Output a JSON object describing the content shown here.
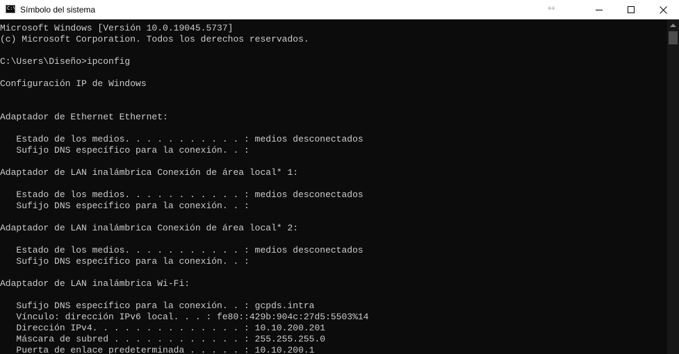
{
  "window": {
    "title": "Símbolo del sistema",
    "resize_glyph": "↔",
    "icon": "cmd-icon",
    "icon_text": "C:\\",
    "controls": [
      "minimize-icon",
      "maximize-icon",
      "close-icon"
    ]
  },
  "console": {
    "text_color": "#cccccc",
    "background": "#0c0c0c",
    "lines": [
      {
        "row": 0,
        "text": "Microsoft Windows [Versión 10.0.19045.5737]"
      },
      {
        "row": 1,
        "text": "(c) Microsoft Corporation. Todos los derechos reservados."
      },
      {
        "row": 3,
        "text": "C:\\Users\\Diseño>ipconfig"
      },
      {
        "row": 5,
        "text": "Configuración IP de Windows"
      },
      {
        "row": 8,
        "text": "Adaptador de Ethernet Ethernet:"
      },
      {
        "row": 10,
        "text": "   Estado de los medios. . . . . . . . . . . : medios desconectados"
      },
      {
        "row": 11,
        "text": "   Sufijo DNS específico para la conexión. . :"
      },
      {
        "row": 13,
        "text": "Adaptador de LAN inalámbrica Conexión de área local* 1:"
      },
      {
        "row": 15,
        "text": "   Estado de los medios. . . . . . . . . . . : medios desconectados"
      },
      {
        "row": 16,
        "text": "   Sufijo DNS específico para la conexión. . :"
      },
      {
        "row": 18,
        "text": "Adaptador de LAN inalámbrica Conexión de área local* 2:"
      },
      {
        "row": 20,
        "text": "   Estado de los medios. . . . . . . . . . . : medios desconectados"
      },
      {
        "row": 21,
        "text": "   Sufijo DNS específico para la conexión. . :"
      },
      {
        "row": 23,
        "text": "Adaptador de LAN inalámbrica Wi-Fi:"
      },
      {
        "row": 25,
        "text": "   Sufijo DNS específico para la conexión. . : gcpds.intra"
      },
      {
        "row": 26,
        "text": "   Vínculo: dirección IPv6 local. . . : fe80::429b:904c:27d5:5503%14"
      },
      {
        "row": 27,
        "text": "   Dirección IPv4. . . . . . . . . . . . . . : 10.10.200.201"
      },
      {
        "row": 28,
        "text": "   Máscara de subred . . . . . . . . . . . . : 255.255.255.0"
      },
      {
        "row": 29,
        "text": "   Puerta de enlace predeterminada . . . . . : 10.10.200.1"
      }
    ]
  },
  "scrollbar": {
    "up_icon": "scroll-up-arrow-icon"
  }
}
